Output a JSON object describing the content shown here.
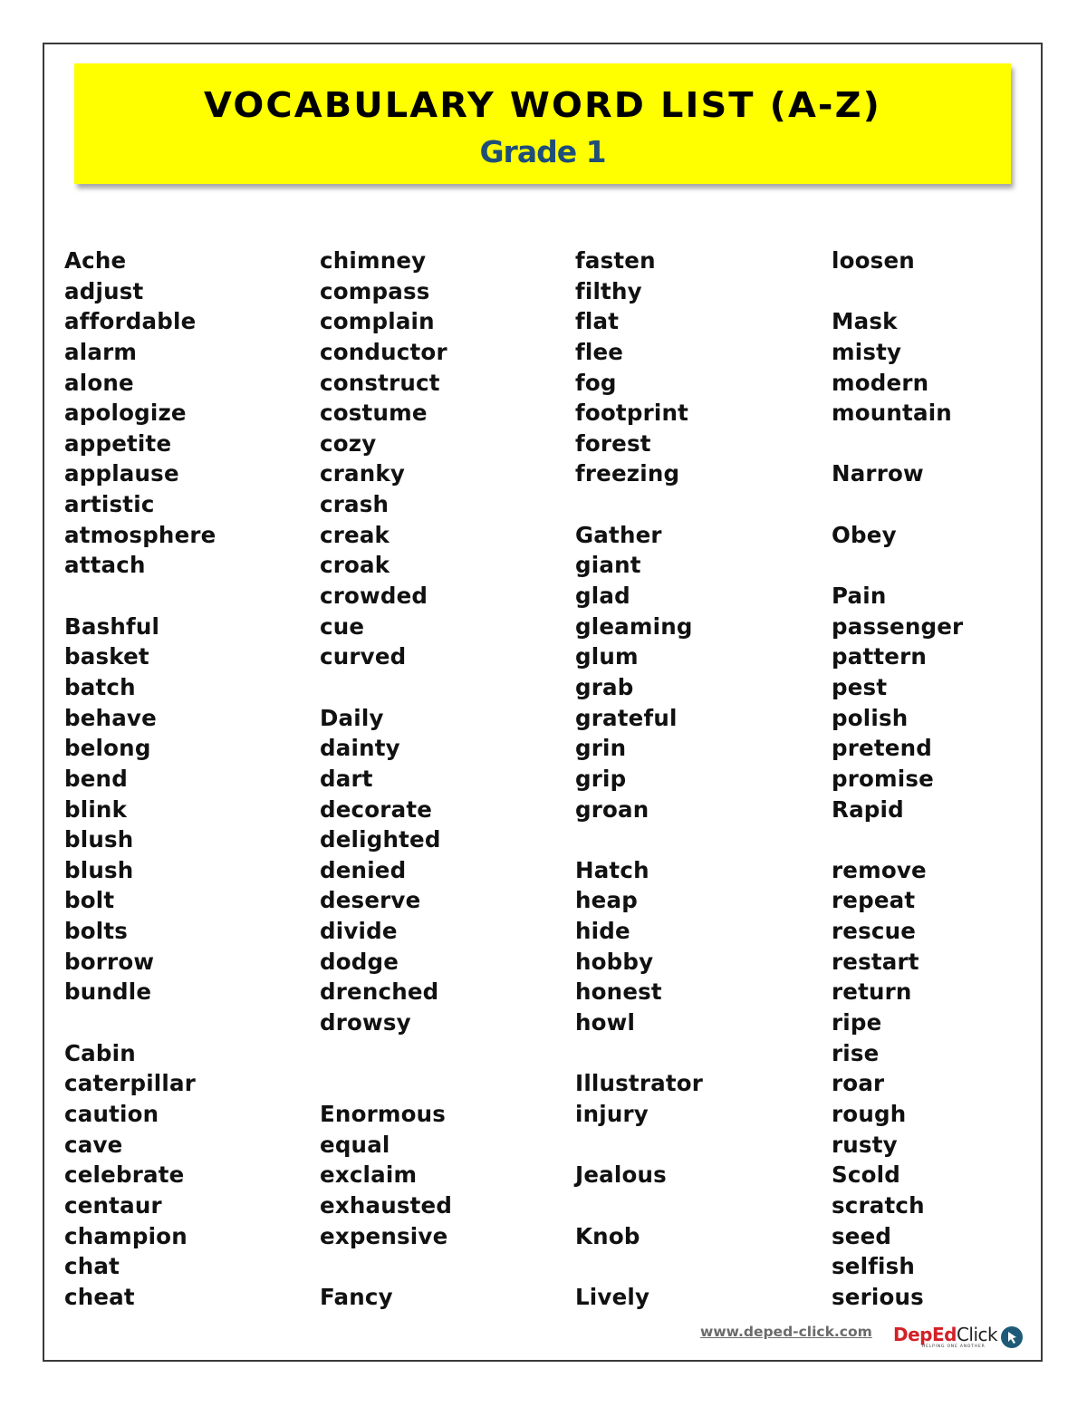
{
  "header": {
    "title": "VOCABULARY WORD LIST (A-Z)",
    "subtitle": "Grade 1"
  },
  "columns": [
    {
      "words": [
        "Ache",
        "adjust",
        "affordable",
        "alarm",
        "alone",
        "apologize",
        "appetite",
        "applause",
        "artistic",
        "atmosphere",
        "attach",
        "",
        "Bashful",
        "basket",
        "batch",
        "behave",
        "belong",
        "bend",
        "blink",
        "blush",
        "blush",
        "bolt",
        "bolts",
        "borrow",
        "bundle",
        "",
        "Cabin",
        "caterpillar",
        "caution",
        "cave",
        "celebrate",
        "centaur",
        "champion",
        "chat",
        "cheat"
      ]
    },
    {
      "words": [
        "chimney",
        "compass",
        "complain",
        "conductor",
        "construct",
        "costume",
        "cozy",
        "cranky",
        "crash",
        "creak",
        "croak",
        "crowded",
        "cue",
        "curved",
        "",
        "Daily",
        "dainty",
        "dart",
        "decorate",
        "delighted",
        "denied",
        "deserve",
        "divide",
        "dodge",
        "drenched",
        "drowsy",
        "",
        "",
        "Enormous",
        "equal",
        "exclaim",
        "exhausted",
        "expensive",
        "",
        "Fancy"
      ]
    },
    {
      "words": [
        "fasten",
        "filthy",
        "flat",
        "flee",
        "fog",
        "footprint",
        "forest",
        "freezing",
        "",
        "Gather",
        "giant",
        "glad",
        "gleaming",
        "glum",
        "grab",
        "grateful",
        "grin",
        "grip",
        "groan",
        "",
        "Hatch",
        "heap",
        "hide",
        "hobby",
        "honest",
        "howl",
        "",
        "Illustrator",
        "injury",
        "",
        "Jealous",
        "",
        "Knob",
        "",
        "Lively"
      ]
    },
    {
      "words": [
        "loosen",
        "",
        "Mask",
        "misty",
        "modern",
        "mountain",
        "",
        "Narrow",
        "",
        "Obey",
        "",
        "Pain",
        "passenger",
        "pattern",
        "pest",
        "polish",
        "pretend",
        "promise",
        "Rapid",
        "",
        "remove",
        "repeat",
        "rescue",
        "restart",
        "return",
        "ripe",
        "rise",
        "roar",
        "rough",
        "rusty",
        "Scold",
        "scratch",
        "seed",
        "selfish",
        "serious"
      ]
    }
  ],
  "footer": {
    "url": "www.deped-click.com",
    "logo_part1": "DepEd",
    "logo_part2": "Click",
    "logo_tagline": "HELPING ONE ANOTHER",
    "logo_icon": "cursor-arrow-icon"
  },
  "colors": {
    "banner": "#ffff00",
    "subtitle": "#1f4e79",
    "logo_red": "#d42027",
    "logo_icon_bg": "#1e5a78"
  }
}
